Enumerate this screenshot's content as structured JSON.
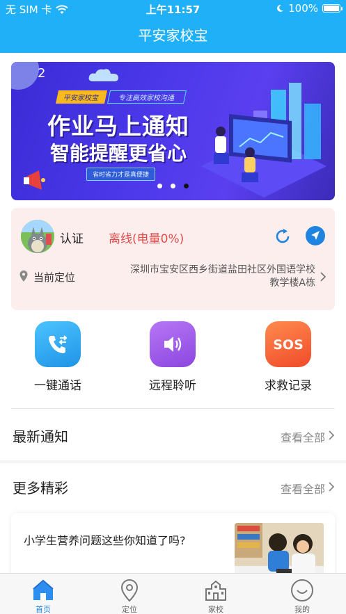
{
  "status_bar": {
    "carrier": "无 SIM 卡",
    "time": "上午11:57",
    "battery": "100%"
  },
  "nav": {
    "title": "平安家校宝"
  },
  "banner": {
    "page_number": "2",
    "tag_brand": "平安家校宝",
    "tag_slogan": "专注高效家校沟通",
    "headline": "作业马上通知",
    "subheadline": "智能提醒更省心",
    "pill": "省时省力才是真便捷",
    "active_dot": 3
  },
  "device_card": {
    "auth_label": "认证",
    "status": "离线(电量0%)",
    "location_label": "当前定位",
    "address_line1": "深圳市宝安区西乡街道盐田社区外国语学校",
    "address_line2": "教学楼A栋"
  },
  "actions": [
    {
      "label": "一键通话",
      "icon": "phone-transfer-icon",
      "color": "#2aa6ee"
    },
    {
      "label": "远程聆听",
      "icon": "speaker-icon",
      "color": "#9d55e6"
    },
    {
      "label": "求救记录",
      "icon": "sos-icon",
      "color": "#f6643a"
    }
  ],
  "latest_notice": {
    "title": "最新通知",
    "more": "查看全部"
  },
  "more_section": {
    "title": "更多精彩",
    "more": "查看全部"
  },
  "article": {
    "title": "小学生营养问题这些你知道了吗?"
  },
  "tabs": [
    {
      "label": "首页",
      "icon": "home-icon",
      "active": true
    },
    {
      "label": "定位",
      "icon": "location-pin-icon",
      "active": false
    },
    {
      "label": "家校",
      "icon": "school-icon",
      "active": false
    },
    {
      "label": "我的",
      "icon": "profile-smile-icon",
      "active": false
    }
  ],
  "colors": {
    "primary": "#1fb0f7",
    "accent_blue": "#1f84e0",
    "alert_red": "#e34b4b",
    "card_bg": "#fdeeee"
  }
}
